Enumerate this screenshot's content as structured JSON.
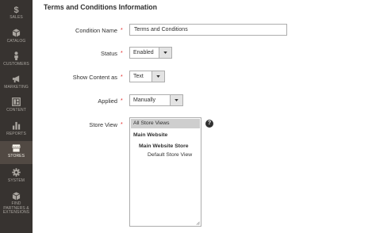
{
  "sidebar": {
    "items": [
      {
        "label": "SALES",
        "icon": "dollar-icon"
      },
      {
        "label": "CATALOG",
        "icon": "cube-icon"
      },
      {
        "label": "CUSTOMERS",
        "icon": "person-icon"
      },
      {
        "label": "MARKETING",
        "icon": "megaphone-icon"
      },
      {
        "label": "CONTENT",
        "icon": "layout-icon"
      },
      {
        "label": "REPORTS",
        "icon": "bar-chart-icon"
      },
      {
        "label": "STORES",
        "icon": "store-icon"
      },
      {
        "label": "SYSTEM",
        "icon": "gear-icon"
      },
      {
        "label": "FIND PARTNERS & EXTENSIONS",
        "icon": "extensions-icon"
      }
    ],
    "active": "STORES"
  },
  "page": {
    "title": "Terms and Conditions Information"
  },
  "form": {
    "condition_name": {
      "label": "Condition Name",
      "value": "Terms and Conditions",
      "required": "*"
    },
    "status": {
      "label": "Status",
      "value": "Enabled",
      "required": "*"
    },
    "show_content_as": {
      "label": "Show Content as",
      "value": "Text",
      "required": "*"
    },
    "applied": {
      "label": "Applied",
      "value": "Manually",
      "required": "*"
    },
    "store_view": {
      "label": "Store View",
      "required": "*",
      "options": [
        "All Store Views",
        "Main Website",
        "Main Website Store",
        "Default Store View"
      ],
      "selected": "All Store Views",
      "help": "?"
    }
  },
  "colors": {
    "sidebar_bg": "#373330",
    "sidebar_active": "#514943",
    "required": "#e22626"
  }
}
